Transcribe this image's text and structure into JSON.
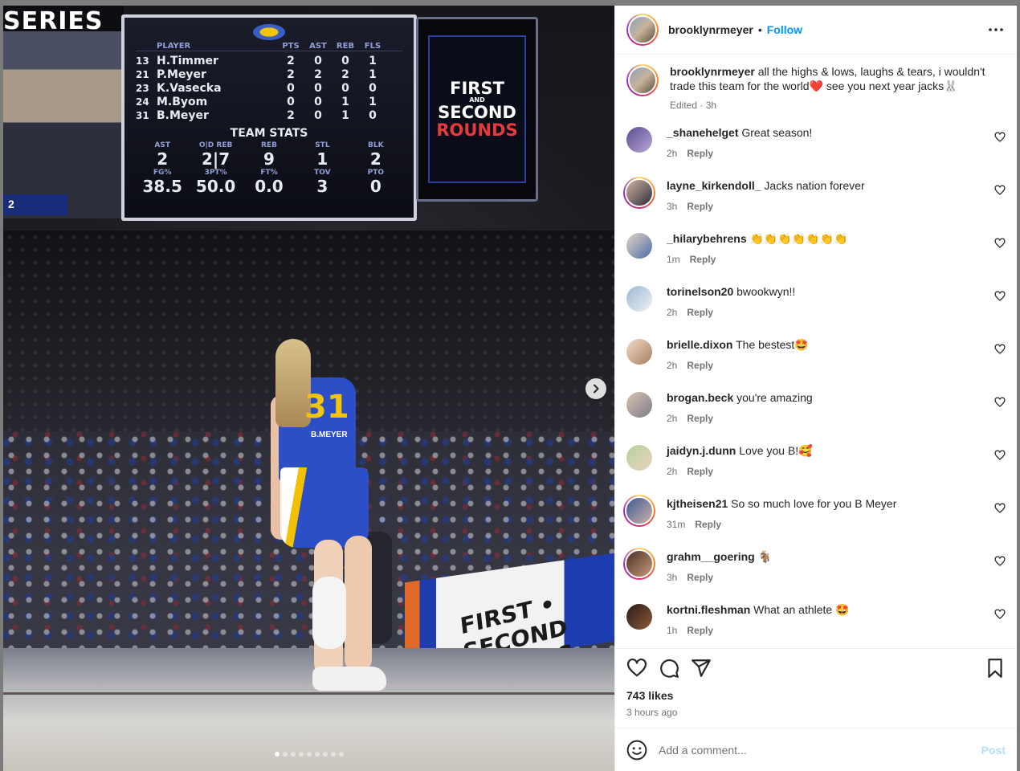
{
  "post": {
    "author": "brooklynrmeyer",
    "separator": "•",
    "follow_label": "Follow",
    "more_icon": "more-horizontal-icon",
    "caption": {
      "username": "brooklynrmeyer",
      "text": "all the highs & lows, laughs & tears, i wouldn't trade this team for the world❤️ see you next year jacks🐰",
      "meta": "Edited · 3h"
    },
    "likes": "743 likes",
    "time": "3 hours ago",
    "add_comment_placeholder": "Add a comment...",
    "post_label": "Post"
  },
  "comments": [
    {
      "username": "_shanehelget",
      "text": "Great season!",
      "time": "2h",
      "reply": "Reply",
      "story": false
    },
    {
      "username": "layne_kirkendoll_",
      "text": "Jacks nation forever",
      "time": "3h",
      "reply": "Reply",
      "story": true
    },
    {
      "username": "_hilarybehrens",
      "text": "👏👏👏👏👏👏👏",
      "time": "1m",
      "reply": "Reply",
      "story": false
    },
    {
      "username": "torinelson20",
      "text": "bwookwyn!!",
      "time": "2h",
      "reply": "Reply",
      "story": false
    },
    {
      "username": "brielle.dixon",
      "text": "The bestest🤩",
      "time": "2h",
      "reply": "Reply",
      "story": false
    },
    {
      "username": "brogan.beck",
      "text": "you're amazing",
      "time": "2h",
      "reply": "Reply",
      "story": false
    },
    {
      "username": "jaidyn.j.dunn",
      "text": "Love you B!🥰",
      "time": "2h",
      "reply": "Reply",
      "story": false
    },
    {
      "username": "kjtheisen21",
      "text": "So so much love for you B Meyer",
      "time": "31m",
      "reply": "Reply",
      "story": true
    },
    {
      "username": "grahm__goering",
      "text": "🐐",
      "time": "3h",
      "reply": "Reply",
      "story": true
    },
    {
      "username": "kortni.fleshman",
      "text": "What an athlete 🤩",
      "time": "1h",
      "reply": "Reply",
      "story": false
    }
  ],
  "media": {
    "arena_banner": "SERIES",
    "mini_score": "2",
    "scoreboard": {
      "head": {
        "player": "PLAYER",
        "pts": "PTS",
        "ast": "AST",
        "reb": "REB",
        "fls": "FLS"
      },
      "rows": [
        {
          "num": "13",
          "name": "H.Timmer",
          "pts": "2",
          "ast": "0",
          "reb": "0",
          "fls": "1"
        },
        {
          "num": "21",
          "name": "P.Meyer",
          "pts": "2",
          "ast": "2",
          "reb": "2",
          "fls": "1"
        },
        {
          "num": "23",
          "name": "K.Vasecka",
          "pts": "0",
          "ast": "0",
          "reb": "0",
          "fls": "0"
        },
        {
          "num": "24",
          "name": "M.Byom",
          "pts": "0",
          "ast": "0",
          "reb": "1",
          "fls": "1"
        },
        {
          "num": "31",
          "name": "B.Meyer",
          "pts": "2",
          "ast": "0",
          "reb": "1",
          "fls": "0"
        }
      ],
      "team_stats_title": "TEAM STATS",
      "team_head1": [
        "AST",
        "O|D REB",
        "REB",
        "STL",
        "BLK"
      ],
      "team_vals1": [
        "2",
        "2|7",
        "9",
        "1",
        "2"
      ],
      "team_head2": [
        "FG%",
        "3PT%",
        "FT%",
        "TOV",
        "PTO"
      ],
      "team_vals2": [
        "38.5",
        "50.0",
        "0.0",
        "3",
        "0"
      ]
    },
    "side_board": {
      "line1": "FIRST",
      "line2": "AND",
      "line3": "SECOND",
      "line4": "ROUNDS"
    },
    "jersey_number": "31",
    "jersey_name": "B.MEYER",
    "barrier_text": "FIRST • SECOND ROUNDS",
    "carousel_count": 9,
    "carousel_active": 0
  },
  "icons": {
    "heart": "heart-icon",
    "comment": "comment-icon",
    "share": "share-icon",
    "bookmark": "bookmark-icon",
    "emoji": "emoji-icon",
    "next": "chevron-right-icon"
  },
  "colors": {
    "accent": "#0095f6",
    "post_disabled": "#b2dffc",
    "secondary_text": "#737373"
  }
}
